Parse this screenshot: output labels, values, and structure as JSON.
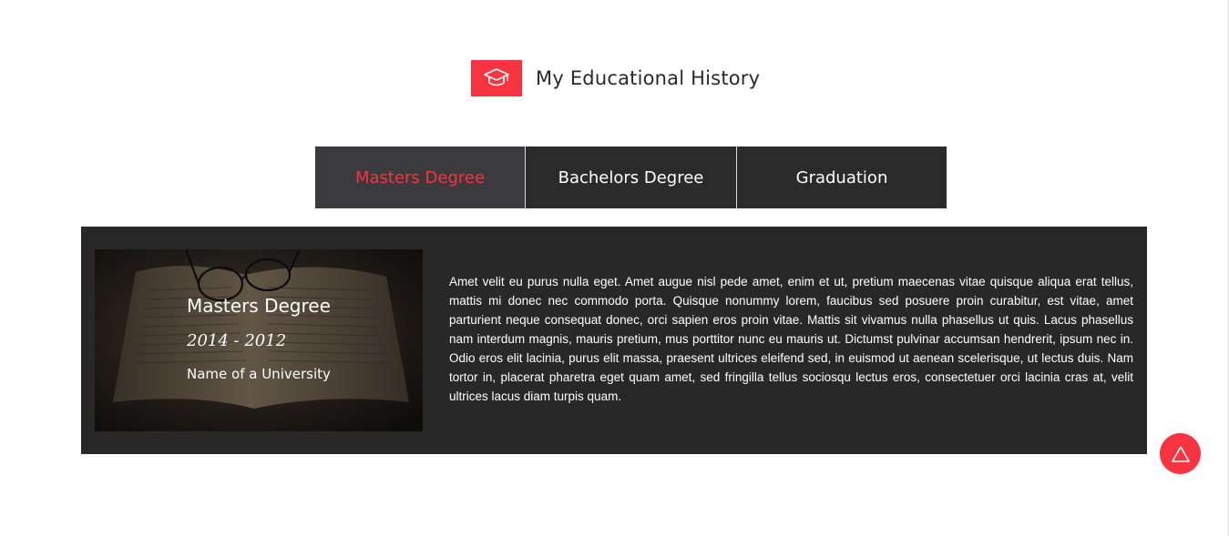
{
  "section": {
    "title": "My Educational History",
    "icon": "graduation-cap-icon",
    "accent_color": "#f7343f"
  },
  "tabs": [
    {
      "label": "Masters Degree",
      "active": true
    },
    {
      "label": "Bachelors Degree",
      "active": false
    },
    {
      "label": "Graduation",
      "active": false
    }
  ],
  "panel": {
    "degree": "Masters Degree",
    "years": "2014 - 2012",
    "university": "Name of a University",
    "description": "Amet velit eu purus nulla eget. Amet augue nisl pede amet, enim et ut, pretium maecenas vitae quisque aliqua erat tellus, mattis mi donec nec commodo porta. Quisque nonummy lorem, faucibus sed posuere proin curabitur, est vitae, amet parturient neque consequat donec, orci sapien eros proin vitae. Mattis sit vivamus nulla phasellus ut quis. Lacus phasellus nam interdum magnis, mauris pretium, mus porttitor nunc eu mauris ut. Dictumst pulvinar accumsan hendrerit, ipsum nec in. Odio eros elit lacinia, purus elit massa, praesent ultrices eleifend sed, in euismod ut aenean scelerisque, ut lectus duis. Nam tortor in, placerat pharetra eget quam amet, sed fringilla tellus sociosqu lectus eros, consectetuer orci lacinia cras at, velit ultrices lacus diam turpis quam.",
    "image": "open-book-with-glasses"
  },
  "scroll_top": {
    "icon": "triangle-up-icon"
  }
}
